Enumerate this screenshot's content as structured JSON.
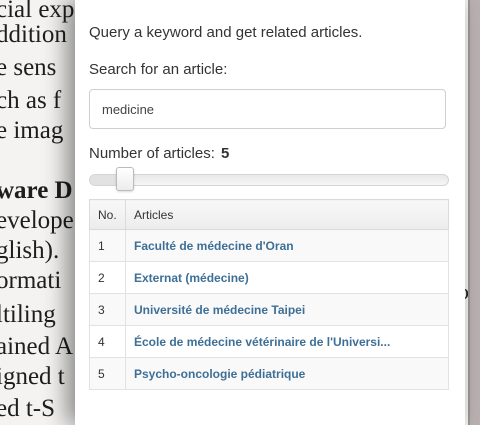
{
  "background_document": {
    "left_lines": [
      {
        "text": "cial exp",
        "bold": false
      },
      {
        "text": "ddition",
        "bold": false
      },
      {
        "text": "e sens",
        "bold": false
      },
      {
        "text": "ch as f",
        "bold": false
      },
      {
        "text": "e imag",
        "bold": false
      },
      {
        "text": "ware D",
        "bold": true
      },
      {
        "text": "evelope",
        "bold": false
      },
      {
        "text": "glish).",
        "bold": false
      },
      {
        "text": "ormati",
        "bold": false
      },
      {
        "text": "ltiling",
        "bold": false
      },
      {
        "text": "ained A",
        "bold": false
      },
      {
        "text": "igned t",
        "bold": false
      },
      {
        "text": "ed t-S",
        "bold": false
      }
    ],
    "right_fragments": [
      "1",
      "o"
    ]
  },
  "panel": {
    "intro": "Query a keyword and get related articles.",
    "search_label": "Search for an article:",
    "search_value": "medicine",
    "count_label": "Number of articles:",
    "count_value": "5",
    "slider": {
      "value": 5,
      "min": 1,
      "max": 100
    },
    "table": {
      "headers": {
        "no": "No.",
        "articles": "Articles"
      },
      "rows": [
        {
          "no": "1",
          "title": "Faculté de médecine d'Oran"
        },
        {
          "no": "2",
          "title": "Externat (médecine)"
        },
        {
          "no": "3",
          "title": "Université de médecine Taipei"
        },
        {
          "no": "4",
          "title": "École de médecine vétérinaire de l'Universi..."
        },
        {
          "no": "5",
          "title": "Psycho-oncologie pédiatrique"
        }
      ]
    }
  },
  "colors": {
    "link": "#3e6f96",
    "panel_bg": "#ffffff",
    "doc_bg": "#f4f3f1"
  }
}
